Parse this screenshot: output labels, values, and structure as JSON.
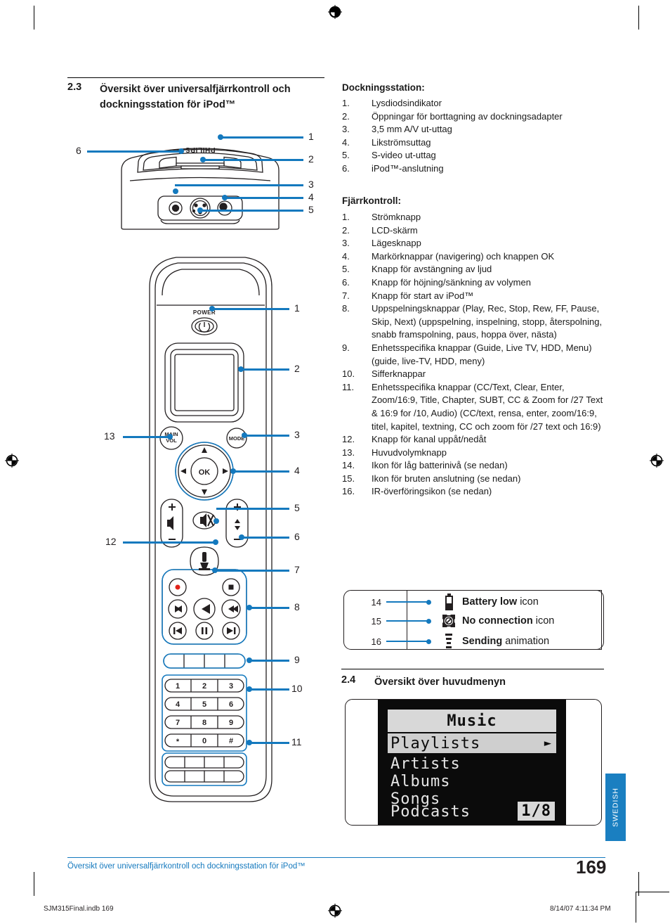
{
  "page": {
    "number": "169",
    "language_tab": "SWEDISH",
    "footer_link": "Översikt över universalfjärrkontroll och dockningsstation för iPod™",
    "slug_left": "SJM315Final.indb   169",
    "slug_right": "8/14/07   4:11:34 PM"
  },
  "section_23": {
    "number": "2.3",
    "title_line1": "Översikt över universalfjärrkontroll och",
    "title_line2": "dockningsstation för iPod™"
  },
  "dock": {
    "heading": "Dockningsstation:",
    "items": [
      {
        "num": "1.",
        "text": "Lysdiodsindikator"
      },
      {
        "num": "2.",
        "text": "Öppningar för borttagning av dockningsadapter"
      },
      {
        "num": "3.",
        "text": "3,5 mm A/V ut-uttag"
      },
      {
        "num": "4.",
        "text": "Likströmsuttag"
      },
      {
        "num": "5.",
        "text": "S-video ut-uttag"
      },
      {
        "num": "6.",
        "text": "iPod™-anslutning"
      }
    ],
    "brand": "PHILIPS",
    "callouts": [
      "1",
      "2",
      "3",
      "4",
      "5",
      "6"
    ]
  },
  "remote": {
    "heading": "Fjärrkontroll:",
    "items": [
      {
        "num": "1.",
        "text": "Strömknapp"
      },
      {
        "num": "2.",
        "text": "LCD-skärm"
      },
      {
        "num": "3.",
        "text": "Lägesknapp"
      },
      {
        "num": "4.",
        "text": "Markörknappar (navigering) och knappen OK"
      },
      {
        "num": "5.",
        "text": "Knapp för avstängning av ljud"
      },
      {
        "num": "6.",
        "text": "Knapp för höjning/sänkning av volymen"
      },
      {
        "num": "7.",
        "text": "Knapp för start av iPod™"
      },
      {
        "num": "8.",
        "text": "Uppspelningsknappar (Play, Rec, Stop, Rew, FF, Pause, Skip, Next) (uppspelning, inspelning, stopp, återspolning, snabb framspolning, paus, hoppa över, nästa)"
      },
      {
        "num": "9.",
        "text": "Enhetsspecifika knappar (Guide, Live TV, HDD, Menu) (guide, live-TV, HDD, meny)"
      },
      {
        "num": "10.",
        "text": "Sifferknappar"
      },
      {
        "num": "11.",
        "text": "Enhetsspecifika knappar (CC/Text, Clear, Enter, Zoom/16:9, Title, Chapter, SUBT, CC & Zoom for /27 Text & 16:9 for /10, Audio) (CC/text, rensa, enter, zoom/16:9, titel, kapitel, textning, CC och zoom för /27 text och 16:9)"
      },
      {
        "num": "12.",
        "text": "Knapp för kanal uppåt/nedåt"
      },
      {
        "num": "13.",
        "text": "Huvudvolymknapp"
      },
      {
        "num": "14.",
        "text": "Ikon för låg batterinivå (se nedan)"
      },
      {
        "num": "15.",
        "text": "Ikon för bruten anslutning (se nedan)"
      },
      {
        "num": "16.",
        "text": "IR-överföringsikon (se nedan)"
      }
    ],
    "power_label": "POWER",
    "mode_label": "MODE",
    "mainvol_label_1": "MAIN",
    "mainvol_label_2": "VOL",
    "ok_label": "OK",
    "keypad": [
      "1",
      "2",
      "3",
      "4",
      "5",
      "6",
      "7",
      "8",
      "9",
      "*",
      "0",
      "#"
    ],
    "callouts": [
      "1",
      "2",
      "3",
      "4",
      "5",
      "6",
      "7",
      "8",
      "9",
      "10",
      "11",
      "12",
      "13"
    ]
  },
  "legend": {
    "rows": [
      {
        "num": "14",
        "icon": "battery-low-icon",
        "bold": "Battery low",
        "rest": "icon"
      },
      {
        "num": "15",
        "icon": "no-connection-icon",
        "bold": "No connection",
        "rest": "icon"
      },
      {
        "num": "16",
        "icon": "sending-icon",
        "bold": "Sending",
        "rest": "animation"
      }
    ]
  },
  "section_24": {
    "number": "2.4",
    "title": "Översikt över huvudmenyn"
  },
  "lcd": {
    "title": "Music",
    "selected": "Playlists",
    "items": [
      "Artists",
      "Albums",
      "Songs",
      "Podcasts"
    ],
    "page_indicator": "1/8"
  },
  "colors": {
    "accent_blue": "#1479be",
    "tab_blue": "#1a7fc1",
    "ink": "#231f20"
  }
}
